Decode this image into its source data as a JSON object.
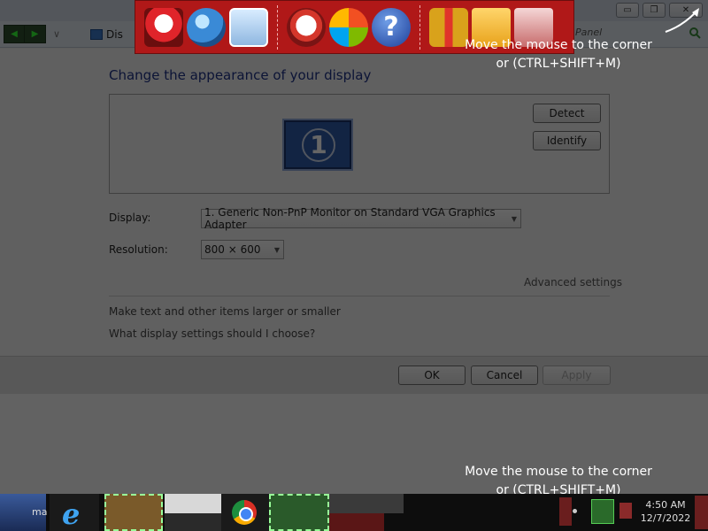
{
  "window": {
    "breadcrumb_partial": "Dis",
    "search_partial": "Panel",
    "controls": {
      "minimize": "▭",
      "maximize": "❐",
      "close": "✕"
    }
  },
  "content": {
    "heading": "Change the appearance of your display",
    "monitor_number": "1",
    "detect_label": "Detect",
    "identify_label": "Identify",
    "display_label": "Display:",
    "display_value": "1. Generic Non-PnP Monitor on Standard VGA Graphics Adapter",
    "resolution_label": "Resolution:",
    "resolution_value": "800 × 600",
    "advanced_link": "Advanced settings",
    "link_text_size": "Make text and other items larger or smaller",
    "link_help": "What display settings should I choose?"
  },
  "footer": {
    "ok_label": "OK",
    "cancel_label": "Cancel",
    "apply_label": "Apply"
  },
  "overlay": {
    "tip_line1": "Move the mouse to the corner",
    "tip_line2": "or (CTRL+SHIFT+M)"
  },
  "taskbar": {
    "santa_partial": "ma",
    "clock_time": "4:50 AM",
    "clock_date": "12/7/2022"
  },
  "colors": {
    "dock_bg": "#b01818",
    "heading": "#1e3287"
  }
}
